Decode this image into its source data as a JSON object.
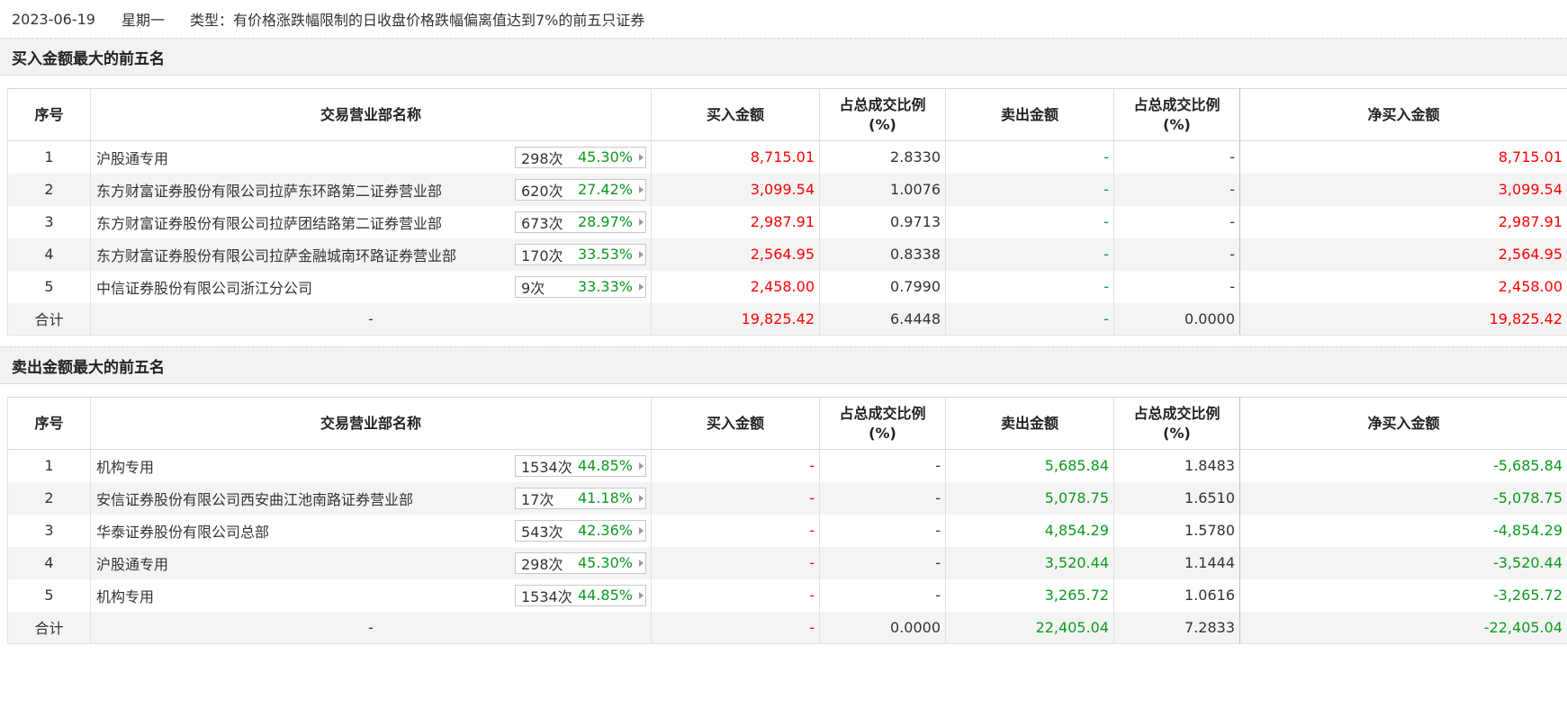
{
  "header": {
    "date": "2023-06-19",
    "weekday": "星期一",
    "type_text": "类型：有价格涨跌幅限制的日收盘价格跌幅偏离值达到7%的前五只证券"
  },
  "columns": {
    "idx": "序号",
    "name": "交易营业部名称",
    "buy": "买入金额",
    "buy_ratio": "占总成交比例",
    "buy_ratio_unit": "(%)",
    "sell": "卖出金额",
    "sell_ratio": "占总成交比例",
    "sell_ratio_unit": "(%)",
    "net": "净买入金额"
  },
  "buy_section": {
    "title": "买入金额最大的前五名",
    "rows": [
      {
        "idx": "1",
        "name": "沪股通专用",
        "count": "298次",
        "pct": "45.30%",
        "buy": "8,715.01",
        "buy_ratio": "2.8330",
        "sell": "-",
        "sell_ratio": "-",
        "net": "8,715.01"
      },
      {
        "idx": "2",
        "name": "东方财富证券股份有限公司拉萨东环路第二证券营业部",
        "count": "620次",
        "pct": "27.42%",
        "buy": "3,099.54",
        "buy_ratio": "1.0076",
        "sell": "-",
        "sell_ratio": "-",
        "net": "3,099.54"
      },
      {
        "idx": "3",
        "name": "东方财富证券股份有限公司拉萨团结路第二证券营业部",
        "count": "673次",
        "pct": "28.97%",
        "buy": "2,987.91",
        "buy_ratio": "0.9713",
        "sell": "-",
        "sell_ratio": "-",
        "net": "2,987.91"
      },
      {
        "idx": "4",
        "name": "东方财富证券股份有限公司拉萨金融城南环路证券营业部",
        "count": "170次",
        "pct": "33.53%",
        "buy": "2,564.95",
        "buy_ratio": "0.8338",
        "sell": "-",
        "sell_ratio": "-",
        "net": "2,564.95"
      },
      {
        "idx": "5",
        "name": "中信证券股份有限公司浙江分公司",
        "count": "9次",
        "pct": "33.33%",
        "buy": "2,458.00",
        "buy_ratio": "0.7990",
        "sell": "-",
        "sell_ratio": "-",
        "net": "2,458.00"
      }
    ],
    "total": {
      "label": "合计",
      "name": "-",
      "buy": "19,825.42",
      "buy_ratio": "6.4448",
      "sell": "-",
      "sell_ratio": "0.0000",
      "net": "19,825.42"
    }
  },
  "sell_section": {
    "title": "卖出金额最大的前五名",
    "rows": [
      {
        "idx": "1",
        "name": "机构专用",
        "count": "1534次",
        "pct": "44.85%",
        "buy": "-",
        "buy_ratio": "-",
        "sell": "5,685.84",
        "sell_ratio": "1.8483",
        "net": "-5,685.84"
      },
      {
        "idx": "2",
        "name": "安信证券股份有限公司西安曲江池南路证券营业部",
        "count": "17次",
        "pct": "41.18%",
        "buy": "-",
        "buy_ratio": "-",
        "sell": "5,078.75",
        "sell_ratio": "1.6510",
        "net": "-5,078.75"
      },
      {
        "idx": "3",
        "name": "华泰证券股份有限公司总部",
        "count": "543次",
        "pct": "42.36%",
        "buy": "-",
        "buy_ratio": "-",
        "sell": "4,854.29",
        "sell_ratio": "1.5780",
        "net": "-4,854.29"
      },
      {
        "idx": "4",
        "name": "沪股通专用",
        "count": "298次",
        "pct": "45.30%",
        "buy": "-",
        "buy_ratio": "-",
        "sell": "3,520.44",
        "sell_ratio": "1.1444",
        "net": "-3,520.44"
      },
      {
        "idx": "5",
        "name": "机构专用",
        "count": "1534次",
        "pct": "44.85%",
        "buy": "-",
        "buy_ratio": "-",
        "sell": "3,265.72",
        "sell_ratio": "1.0616",
        "net": "-3,265.72"
      }
    ],
    "total": {
      "label": "合计",
      "name": "-",
      "buy": "-",
      "buy_ratio": "0.0000",
      "sell": "22,405.04",
      "sell_ratio": "7.2833",
      "net": "-22,405.04"
    }
  },
  "colors": {
    "up": "#ff0000",
    "down": "#0c9a1e",
    "neutral": "#333333"
  },
  "icons": {
    "badge_arrow": "triangle-right-icon"
  }
}
